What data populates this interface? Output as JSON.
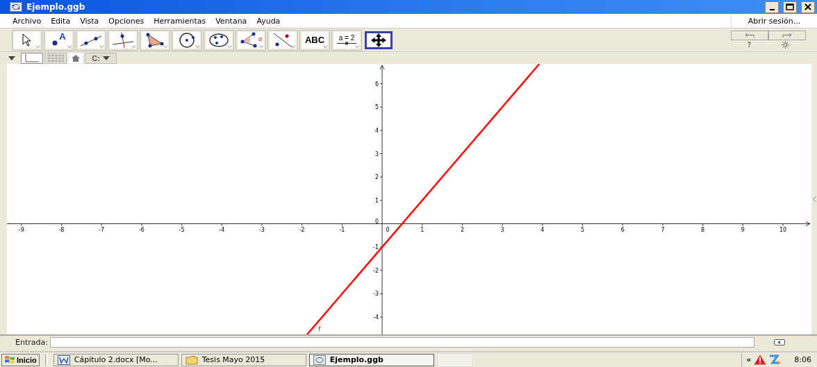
{
  "window": {
    "title": "Ejemplo.ggb"
  },
  "menu": [
    "Archivo",
    "Edita",
    "Vista",
    "Opciones",
    "Herramientas",
    "Ventana",
    "Ayuda"
  ],
  "login": "Abrir sesión...",
  "tools": [
    {
      "kind": "move",
      "selected": false
    },
    {
      "kind": "point",
      "label": "A",
      "selected": false
    },
    {
      "kind": "line",
      "selected": false
    },
    {
      "kind": "perpendicular",
      "selected": false
    },
    {
      "kind": "polygon",
      "selected": false
    },
    {
      "kind": "circle",
      "selected": false
    },
    {
      "kind": "conic",
      "selected": false
    },
    {
      "kind": "angle",
      "label": "α",
      "selected": false
    },
    {
      "kind": "reflect",
      "selected": false
    },
    {
      "kind": "text",
      "label": "ABC",
      "selected": false
    },
    {
      "kind": "slider",
      "label": "a = 2",
      "selected": false
    },
    {
      "kind": "pan",
      "selected": true
    }
  ],
  "style_bar": {
    "axes_on": true,
    "grid_on": false,
    "capture": "C:"
  },
  "help": "?",
  "graphics": {
    "origin_label": "0",
    "chart_data": {
      "type": "line",
      "x": [
        -1.87,
        3.92
      ],
      "series": [
        {
          "name": "f",
          "color": "#ff0000",
          "values": [
            -4.74,
            6.84
          ]
        }
      ],
      "xlim": [
        -9.36,
        10.71
      ],
      "ylim": [
        -4.74,
        6.85
      ],
      "xticks": [
        -9,
        -8,
        -7,
        -6,
        -5,
        -4,
        -3,
        -2,
        -1,
        1,
        2,
        3,
        4,
        5,
        6,
        7,
        8,
        9,
        10
      ],
      "yticks": [
        -4,
        -3,
        -2,
        -1,
        0,
        1,
        2,
        3,
        4,
        5,
        6
      ]
    }
  },
  "input_bar": {
    "label": "Entrada:"
  },
  "taskbar": {
    "start": "Inicio",
    "tasks": [
      {
        "kind": "word",
        "label": "Cápitulo 2.docx [Mo...",
        "selected": false
      },
      {
        "kind": "folder",
        "label": "Tesis Mayo 2015",
        "selected": false
      },
      {
        "kind": "geogebra",
        "label": "Ejemplo.ggb",
        "selected": true
      }
    ],
    "tray_expand": "«",
    "clock": "8:06"
  }
}
